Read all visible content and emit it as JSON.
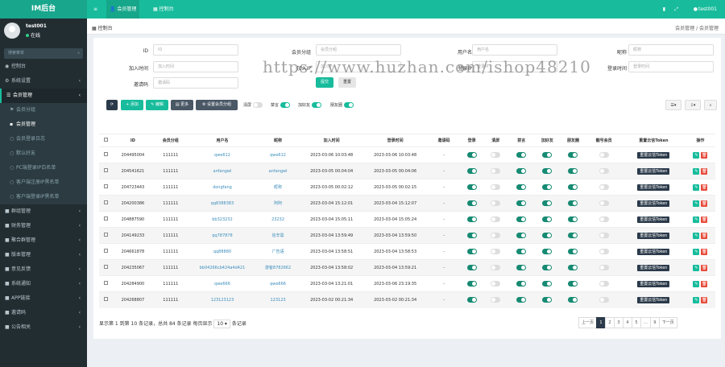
{
  "brand": "IM后台",
  "topbar": {
    "menu_icon": "≡",
    "tabs": [
      {
        "icon": "👤",
        "label": "会员管理"
      },
      {
        "icon": "▦",
        "label": "控制台"
      }
    ],
    "user": "test001"
  },
  "sidebar": {
    "user": {
      "name": "test001",
      "status": "在线"
    },
    "search_placeholder": "搜索菜单",
    "items": [
      {
        "label": "控制台",
        "icon": "◉"
      },
      {
        "label": "系统设置",
        "icon": "⚙"
      },
      {
        "label": "会员管理",
        "icon": "☰"
      },
      {
        "label": "会员分组",
        "icon": "⚑"
      },
      {
        "label": "会员管理",
        "icon": "▪"
      },
      {
        "label": "会员登录日志",
        "icon": "○"
      },
      {
        "label": "默认好友",
        "icon": "○"
      },
      {
        "label": "PC端登录IP白名单",
        "icon": "○"
      },
      {
        "label": "客户端注册IP黑名单",
        "icon": "○"
      },
      {
        "label": "客户端登录IP黑名单",
        "icon": "○"
      },
      {
        "label": "群组管理",
        "icon": "■"
      },
      {
        "label": "财务管理",
        "icon": "■"
      },
      {
        "label": "聚合群管理",
        "icon": "■"
      },
      {
        "label": "版本管理",
        "icon": "■"
      },
      {
        "label": "意见反馈",
        "icon": "■"
      },
      {
        "label": "系统通知",
        "icon": "■"
      },
      {
        "label": "APP链接",
        "icon": "■"
      },
      {
        "label": "邀请码",
        "icon": "■"
      },
      {
        "label": "公告相关",
        "icon": "■"
      }
    ]
  },
  "breadcrumb": {
    "left": "控制台",
    "right": "会员管理 / 会员管理"
  },
  "filters": [
    {
      "label": "ID",
      "placeholder": "ID"
    },
    {
      "label": "会员分组",
      "placeholder": "会员分组"
    },
    {
      "label": "用户名",
      "placeholder": "用户名"
    },
    {
      "label": "昵称",
      "placeholder": "昵称"
    },
    {
      "label": "加入时间",
      "placeholder": "加入时间"
    },
    {
      "label": "加入IP",
      "placeholder": "加入IP"
    },
    {
      "label": "登录IP",
      "placeholder": "登录IP"
    },
    {
      "label": "登录时间",
      "placeholder": "登录时间"
    },
    {
      "label": "邀请码",
      "placeholder": "邀请码"
    }
  ],
  "submit": "提交",
  "reset": "重置",
  "toolbar": {
    "add": "+ 添加",
    "edit": "✎ 编辑",
    "more": "▤ 更多",
    "group": "⚙ 设置会员分组",
    "clean_label": "清屏",
    "ban_label": "禁言",
    "addfriend_label": "加好友",
    "circle_label": "朋友圈"
  },
  "columns": [
    "ID",
    "会员分组",
    "用户名",
    "昵称",
    "加入时间",
    "登录时间",
    "邀请码",
    "登录",
    "清屏",
    "禁言",
    "加好友",
    "朋友圈",
    "靓号会员",
    "重置云信Token",
    "操作"
  ],
  "rows": [
    {
      "id": "204495004",
      "group": "111111",
      "user": "qwe612",
      "nick": "qwe612",
      "join": "2023-03-06 10:03:48",
      "login": "2023-03-06 10:03:48",
      "code": "-"
    },
    {
      "id": "204541621",
      "group": "111111",
      "user": "anfangwl",
      "nick": "anfangwl",
      "join": "2023-03-05 00:04:04",
      "login": "2023-03-05 00:04:06",
      "code": "-"
    },
    {
      "id": "204723443",
      "group": "111111",
      "user": "dongfang",
      "nick": "昵称",
      "join": "2023-03-05 00:02:12",
      "login": "2023-03-05 00:02:15",
      "code": "-"
    },
    {
      "id": "204200386",
      "group": "111111",
      "user": "qq8388383",
      "nick": "阿阿",
      "join": "2023-03-04 15:12:01",
      "login": "2023-03-04 15:12:07",
      "code": "-"
    },
    {
      "id": "204887590",
      "group": "111111",
      "user": "bb323232",
      "nick": "23232",
      "join": "2023-03-04 15:05:11",
      "login": "2023-03-04 15:05:24",
      "code": "-"
    },
    {
      "id": "204149233",
      "group": "111111",
      "user": "qq787878",
      "nick": "信辛需",
      "join": "2023-03-04 13:59:49",
      "login": "2023-03-04 13:59:50",
      "code": "-"
    },
    {
      "id": "204661878",
      "group": "111111",
      "user": "qq88880",
      "nick": "广告语",
      "join": "2023-03-04 13:58:51",
      "login": "2023-03-04 13:58:53",
      "code": "-"
    },
    {
      "id": "204235067",
      "group": "111111",
      "user": "bb04266cb424a4d421",
      "nick": "游客8782662",
      "join": "2023-03-04 13:58:02",
      "login": "2023-03-04 13:59:21",
      "code": "-"
    },
    {
      "id": "204284900",
      "group": "111111",
      "user": "qwe666",
      "nick": "qwe666",
      "join": "2023-03-04 13:21:01",
      "login": "2023-03-06 23:19:35",
      "code": "-"
    },
    {
      "id": "204268807",
      "group": "111111",
      "user": "123123123",
      "nick": "123123",
      "join": "2023-03-02 00:21:34",
      "login": "2023-03-02 00:21:34",
      "code": "-"
    }
  ],
  "token_btn": "重置云信Token",
  "footer": {
    "info": "显示第 1 到第 10 条记录，总共 84 条记录 每页显示",
    "page_size": "10 ▾",
    "suffix": "条记录"
  },
  "pager": [
    "上一页",
    "1",
    "2",
    "3",
    "4",
    "5",
    "...",
    "9",
    "下一页"
  ],
  "watermark": "https://www.huzhan.com/ishop48210",
  "colors": {
    "accent": "#18bc9c",
    "sidebar": "#222d32",
    "danger": "#e74c3c"
  }
}
